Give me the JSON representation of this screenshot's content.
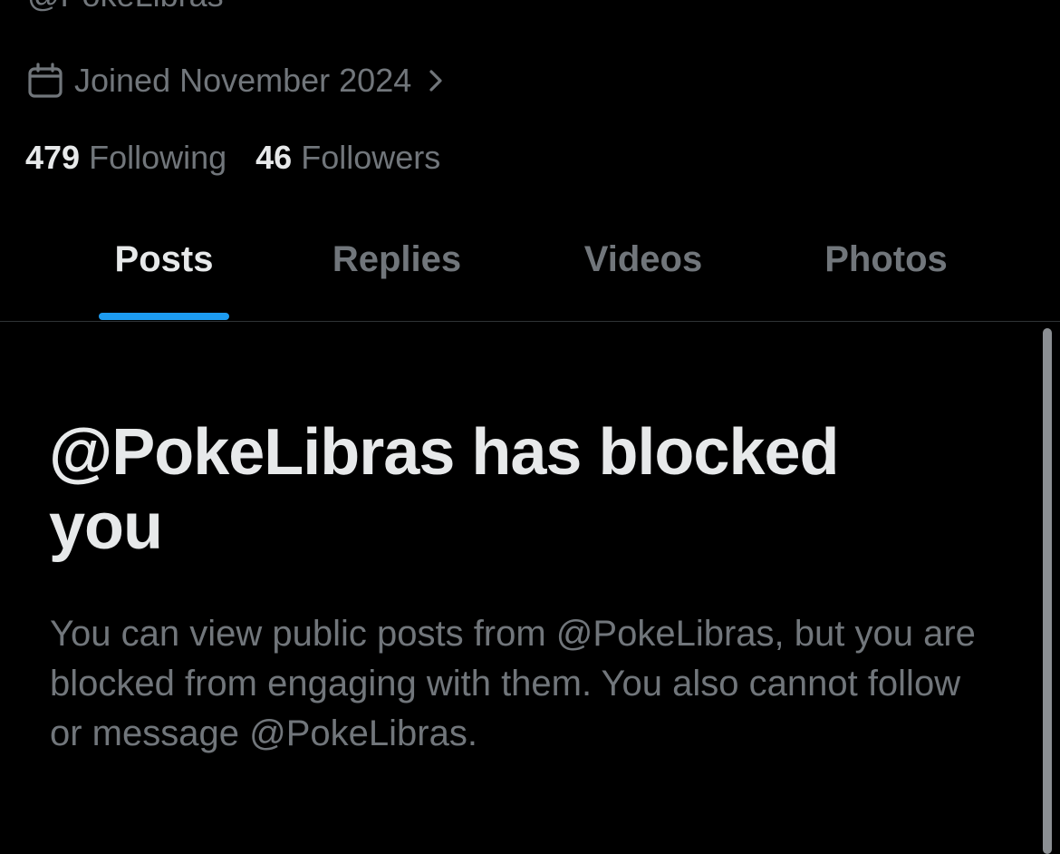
{
  "profile": {
    "handle_partial": "@PokeLibras",
    "joined_label": "Joined November 2024",
    "following_count": "479",
    "following_label": "Following",
    "followers_count": "46",
    "followers_label": "Followers"
  },
  "tabs": [
    {
      "label": "Posts",
      "active": true
    },
    {
      "label": "Replies",
      "active": false
    },
    {
      "label": "Videos",
      "active": false
    },
    {
      "label": "Photos",
      "active": false
    }
  ],
  "blocked": {
    "title": "@PokeLibras has blocked you",
    "body": "You can view public posts from @PokeLibras, but you are blocked from engaging with them. You also cannot follow or message @PokeLibras."
  },
  "colors": {
    "background": "#000000",
    "primary_text": "#e7e9ea",
    "secondary_text": "#71767b",
    "accent": "#1d9bf0",
    "divider": "#2f3336"
  },
  "icons": {
    "calendar": "calendar-icon",
    "chevron": "chevron-right-icon"
  }
}
